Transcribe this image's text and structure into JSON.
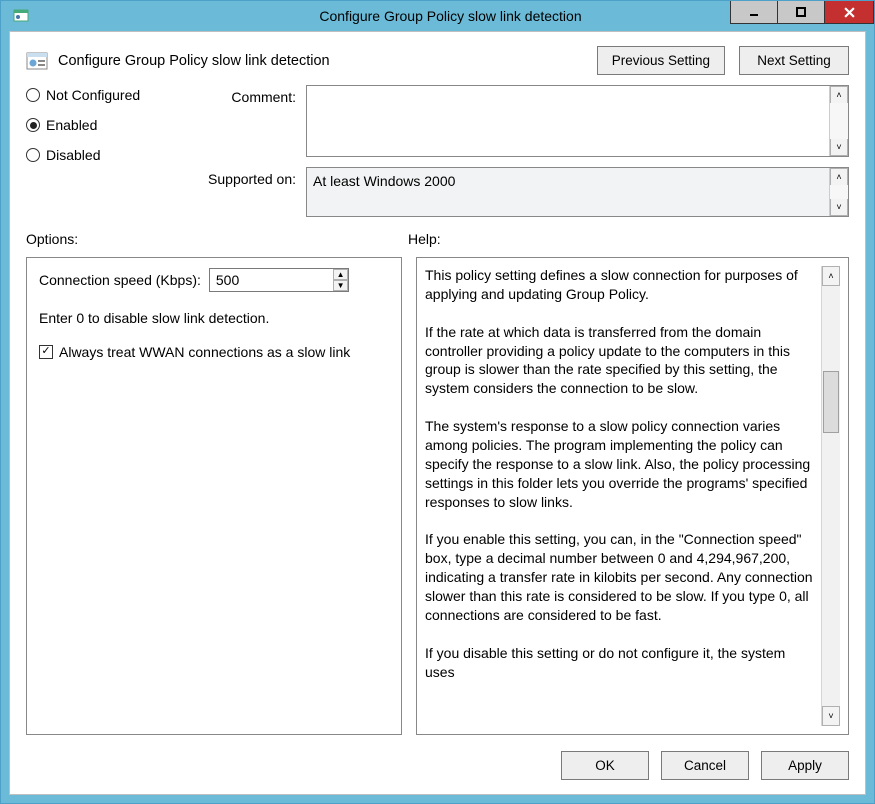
{
  "window": {
    "title": "Configure Group Policy slow link detection"
  },
  "header": {
    "policy_name": "Configure Group Policy slow link detection",
    "prev_btn": "Previous Setting",
    "next_btn": "Next Setting"
  },
  "state": {
    "not_configured": "Not Configured",
    "enabled": "Enabled",
    "disabled": "Disabled",
    "selected": "enabled"
  },
  "fields": {
    "comment_label": "Comment:",
    "comment_value": "",
    "supported_label": "Supported on:",
    "supported_value": "At least Windows 2000"
  },
  "section_labels": {
    "options": "Options:",
    "help": "Help:"
  },
  "options": {
    "speed_label": "Connection speed (Kbps):",
    "speed_value": "500",
    "note": "Enter 0 to disable slow link detection.",
    "wwan_label": "Always treat WWAN connections as a slow link",
    "wwan_checked": true
  },
  "help_text": "This policy setting defines a slow connection for purposes of applying and updating Group Policy.\n\nIf the rate at which data is transferred from the domain controller providing a policy update to the computers in this group is slower than the rate specified by this setting, the system considers the connection to be slow.\n\nThe system's response to a slow policy connection varies among policies. The program implementing the policy can specify the response to a slow link. Also, the policy processing settings in this folder lets you override the programs' specified responses to slow links.\n\nIf you enable this setting, you can, in the \"Connection speed\" box, type a decimal number between 0 and 4,294,967,200, indicating a transfer rate in kilobits per second. Any connection slower than this rate is considered to be slow. If you type 0, all connections are considered to be fast.\n\nIf you disable this setting or do not configure it, the system uses",
  "footer": {
    "ok": "OK",
    "cancel": "Cancel",
    "apply": "Apply"
  }
}
